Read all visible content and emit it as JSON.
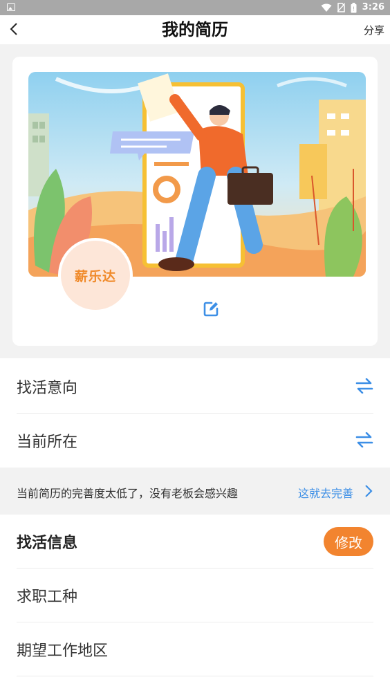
{
  "status_bar": {
    "time": "3:26"
  },
  "header": {
    "title": "我的简历",
    "share_label": "分享"
  },
  "profile": {
    "avatar_text": "薪乐达"
  },
  "rows": [
    {
      "label": "找活意向"
    },
    {
      "label": "当前所在"
    }
  ],
  "tip": {
    "text": "当前简历的完善度太低了，没有老板会感兴趣",
    "link_label": "这就去完善"
  },
  "job_info": {
    "title": "找活信息",
    "edit_label": "修改",
    "items": [
      {
        "label": "求职工种"
      },
      {
        "label": "期望工作地区"
      }
    ]
  },
  "colors": {
    "accent_blue": "#3d8fe6",
    "accent_orange": "#f2842f"
  }
}
